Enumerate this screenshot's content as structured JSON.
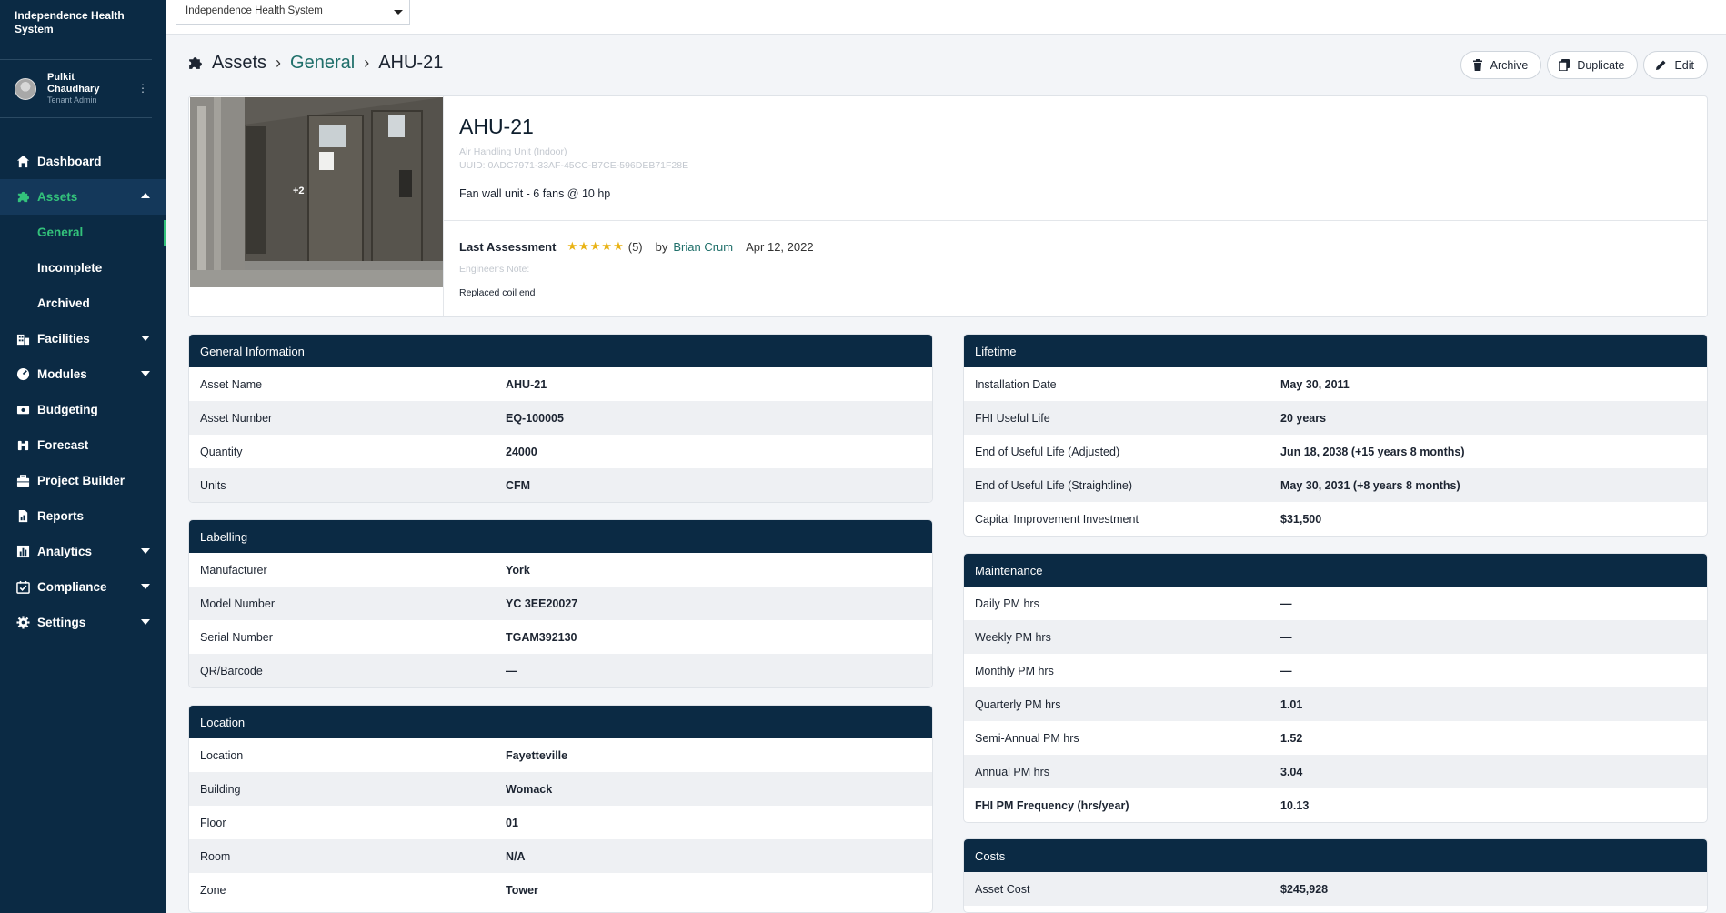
{
  "sidebar": {
    "org_name": "Independence Health System",
    "user": {
      "name": "Pulkit Chaudhary",
      "role": "Tenant Admin"
    },
    "nav": {
      "dashboard": "Dashboard",
      "assets": "Assets",
      "assets_sub": {
        "general": "General",
        "incomplete": "Incomplete",
        "archived": "Archived"
      },
      "facilities": "Facilities",
      "modules": "Modules",
      "budgeting": "Budgeting",
      "forecast": "Forecast",
      "project_builder": "Project Builder",
      "reports": "Reports",
      "analytics": "Analytics",
      "compliance": "Compliance",
      "settings": "Settings"
    }
  },
  "topbar": {
    "system_select": "Independence Health System"
  },
  "breadcrumb": {
    "root": "Assets",
    "section": "General",
    "current": "AHU-21"
  },
  "actions": {
    "archive": "Archive",
    "duplicate": "Duplicate",
    "edit": "Edit"
  },
  "asset": {
    "title": "AHU-21",
    "type": "Air Handling Unit (Indoor)",
    "uuid": "UUID: 0ADC7971-33AF-45CC-B7CE-596DEB71F28E",
    "description": "Fan wall unit - 6 fans @ 10 hp",
    "photo_more": "+2",
    "assessment": {
      "label": "Last Assessment",
      "rating": 5,
      "count": "(5)",
      "by": "by",
      "assessor": "Brian Crum",
      "date": "Apr 12, 2022",
      "note_label": "Engineer's Note:",
      "note": "Replaced coil end"
    }
  },
  "general_info": {
    "title": "General Information",
    "rows": [
      {
        "k": "Asset Name",
        "v": "AHU-21"
      },
      {
        "k": "Asset Number",
        "v": "EQ-100005"
      },
      {
        "k": "Quantity",
        "v": "24000"
      },
      {
        "k": "Units",
        "v": "CFM"
      }
    ]
  },
  "labelling": {
    "title": "Labelling",
    "rows": [
      {
        "k": "Manufacturer",
        "v": "York"
      },
      {
        "k": "Model Number",
        "v": "YC 3EE20027"
      },
      {
        "k": "Serial Number",
        "v": "TGAM392130"
      },
      {
        "k": "QR/Barcode",
        "v": "—"
      }
    ]
  },
  "location": {
    "title": "Location",
    "rows": [
      {
        "k": "Location",
        "v": "Fayetteville"
      },
      {
        "k": "Building",
        "v": "Womack"
      },
      {
        "k": "Floor",
        "v": "01"
      },
      {
        "k": "Room",
        "v": "N/A"
      },
      {
        "k": "Zone",
        "v": "Tower"
      }
    ]
  },
  "lifetime": {
    "title": "Lifetime",
    "rows": [
      {
        "k": "Installation Date",
        "v": "May 30, 2011"
      },
      {
        "k": "FHI Useful Life",
        "v": "20 years"
      },
      {
        "k": "End of Useful Life (Adjusted)",
        "v": "Jun 18, 2038 (+15 years 8 months)"
      },
      {
        "k": "End of Useful Life (Straightline)",
        "v": "May 30, 2031 (+8 years 8 months)"
      },
      {
        "k": "Capital Improvement Investment",
        "v": "$31,500"
      }
    ]
  },
  "maintenance": {
    "title": "Maintenance",
    "rows": [
      {
        "k": "Daily PM hrs",
        "v": "—"
      },
      {
        "k": "Weekly PM hrs",
        "v": "—"
      },
      {
        "k": "Monthly PM hrs",
        "v": "—"
      },
      {
        "k": "Quarterly PM hrs",
        "v": "1.01"
      },
      {
        "k": "Semi-Annual PM hrs",
        "v": "1.52"
      },
      {
        "k": "Annual PM hrs",
        "v": "3.04"
      },
      {
        "k": "FHI PM Frequency (hrs/year)",
        "v": "10.13"
      }
    ]
  },
  "costs": {
    "title": "Costs",
    "rows": [
      {
        "k": "Asset Cost",
        "v": "$245,928"
      }
    ]
  },
  "colors": {
    "sidebar": "#0b2a44",
    "accent": "#33c27b",
    "link": "#1f6f6a",
    "star": "#e9b315"
  }
}
